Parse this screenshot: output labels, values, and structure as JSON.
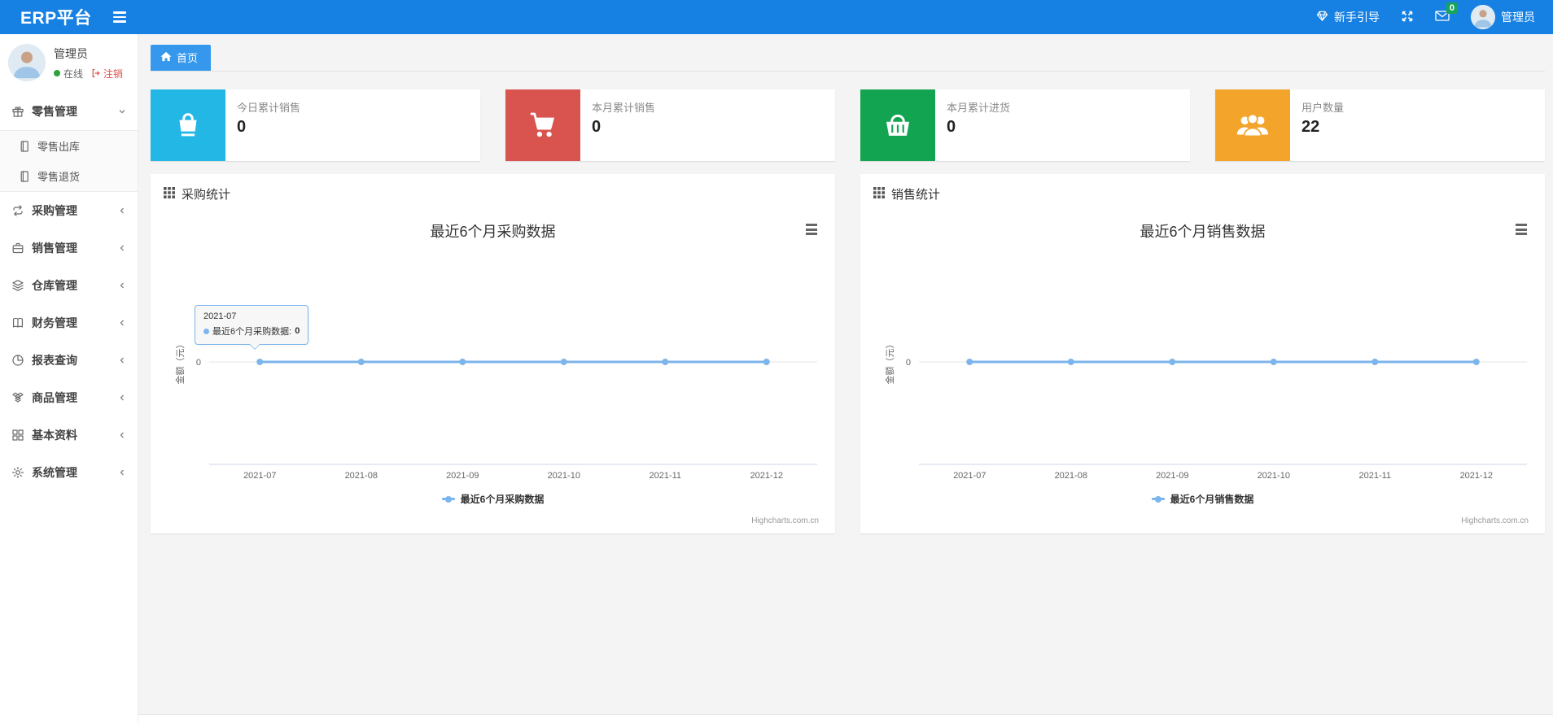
{
  "header": {
    "brand": "ERP平台",
    "guide_label": "新手引导",
    "mail_badge": "0",
    "user_label": "管理员"
  },
  "sidebar": {
    "user": {
      "name": "管理员",
      "status": "在线",
      "logout": "注销"
    },
    "menu": [
      {
        "id": "retail",
        "label": "零售管理",
        "icon": "gift-icon",
        "expanded": true,
        "children": [
          {
            "id": "retail-outbound",
            "label": "零售出库",
            "icon": "file-icon"
          },
          {
            "id": "retail-return",
            "label": "零售退货",
            "icon": "file-icon"
          }
        ]
      },
      {
        "id": "purchase",
        "label": "采购管理",
        "icon": "repeat-icon",
        "expanded": false
      },
      {
        "id": "sales",
        "label": "销售管理",
        "icon": "briefcase-icon",
        "expanded": false
      },
      {
        "id": "warehouse",
        "label": "仓库管理",
        "icon": "layers-icon",
        "expanded": false
      },
      {
        "id": "finance",
        "label": "财务管理",
        "icon": "book-icon",
        "expanded": false
      },
      {
        "id": "reports",
        "label": "报表查询",
        "icon": "pie-chart-icon",
        "expanded": false
      },
      {
        "id": "goods",
        "label": "商品管理",
        "icon": "dropbox-icon",
        "expanded": false
      },
      {
        "id": "basic-data",
        "label": "基本资料",
        "icon": "th-large-icon",
        "expanded": false
      },
      {
        "id": "system",
        "label": "系统管理",
        "icon": "gear-icon",
        "expanded": false
      }
    ]
  },
  "tabs": [
    {
      "id": "home",
      "label": "首页",
      "icon": "home-icon",
      "active": true
    }
  ],
  "stats": [
    {
      "id": "today-sales",
      "label": "今日累计销售",
      "value": "0",
      "color": "#23b7e5",
      "icon": "shopping-bag-icon"
    },
    {
      "id": "month-sales",
      "label": "本月累计销售",
      "value": "0",
      "color": "#d9534f",
      "icon": "shopping-cart-icon"
    },
    {
      "id": "month-purchase",
      "label": "本月累计进货",
      "value": "0",
      "color": "#13a452",
      "icon": "shopping-basket-icon"
    },
    {
      "id": "user-count",
      "label": "用户数量",
      "value": "22",
      "color": "#f3a42b",
      "icon": "users-icon"
    }
  ],
  "panels": [
    {
      "id": "purchase-stats",
      "title": "采购统计"
    },
    {
      "id": "sales-stats",
      "title": "销售统计"
    }
  ],
  "chart_data": [
    {
      "type": "line",
      "title": "最近6个月采购数据",
      "categories": [
        "2021-07",
        "2021-08",
        "2021-09",
        "2021-10",
        "2021-11",
        "2021-12"
      ],
      "series": [
        {
          "name": "最近6个月采购数据",
          "values": [
            0,
            0,
            0,
            0,
            0,
            0
          ]
        }
      ],
      "xlabel": "",
      "ylabel": "金额（元）",
      "ylim": [
        -1,
        1
      ],
      "yticks": [
        "0"
      ],
      "grid": true,
      "legend_position": "bottom",
      "line_color": "#7cb5ec",
      "credit": "Highcharts.com.cn",
      "tooltip": {
        "visible": true,
        "category": "2021-07",
        "series_label": "最近6个月采购数据:",
        "value": "0"
      }
    },
    {
      "type": "line",
      "title": "最近6个月销售数据",
      "categories": [
        "2021-07",
        "2021-08",
        "2021-09",
        "2021-10",
        "2021-11",
        "2021-12"
      ],
      "series": [
        {
          "name": "最近6个月销售数据",
          "values": [
            0,
            0,
            0,
            0,
            0,
            0
          ]
        }
      ],
      "xlabel": "",
      "ylabel": "金额（元）",
      "ylim": [
        -1,
        1
      ],
      "yticks": [
        "0"
      ],
      "grid": true,
      "legend_position": "bottom",
      "line_color": "#7cb5ec",
      "credit": "Highcharts.com.cn",
      "tooltip": {
        "visible": false
      }
    }
  ]
}
